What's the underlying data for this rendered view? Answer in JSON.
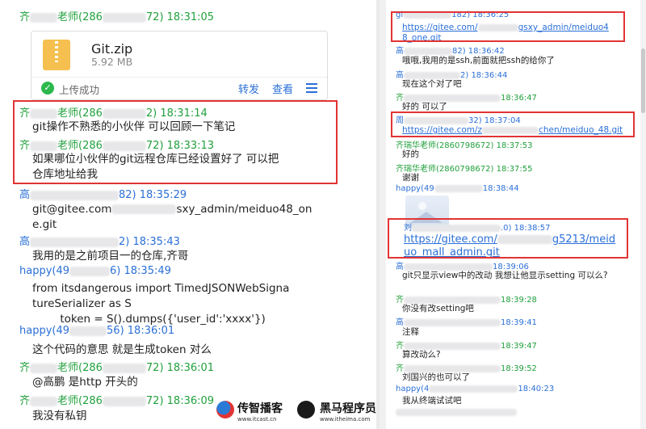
{
  "left": {
    "messages": [
      {
        "sender_a": "齐",
        "sender_b": "老师(286",
        "sender_c": "72) 18:31:05",
        "color": "green"
      },
      {
        "sender_a": "齐",
        "sender_b": "老师(286",
        "sender_c": "2) 18:31:14",
        "color": "green",
        "text": "git操作不熟悉的小伙伴 可以回顾一下笔记"
      },
      {
        "sender_a": "齐",
        "sender_b": "老师(286",
        "sender_c": "72) 18:33:13",
        "color": "green",
        "text": "如果哪位小伙伴的git远程仓库已经设置好了 可以把\n仓库地址给我"
      },
      {
        "sender_a": "高",
        "sender_b": "",
        "sender_c": "82) 18:35:29",
        "color": "blue",
        "text": "git@gitee.com",
        "text2": "sxy_admin/meiduo48_on\ne.git"
      },
      {
        "sender_a": "高",
        "sender_b": "",
        "sender_c": "2) 18:35:43",
        "color": "blue",
        "text": "我用的是之前项目一的仓库,齐哥"
      },
      {
        "sender_a": "happy(49",
        "sender_b": "",
        "sender_c": "6) 18:35:49",
        "color": "blue",
        "text": "from itsdangerous import TimedJSONWebSigna\ntureSerializer as S\n        token = S().dumps({'user_id':'xxxx'})"
      },
      {
        "sender_a": "happy(49",
        "sender_b": "",
        "sender_c": "56) 18:36:01",
        "color": "blue",
        "text": "这个代码的意思 就是生成token 对么"
      },
      {
        "sender_a": "齐",
        "sender_b": "老师(286",
        "sender_c": "72) 18:36:01",
        "color": "green",
        "text": "@高鹏 是http 开头的"
      },
      {
        "sender_a": "齐",
        "sender_b": "老师(286",
        "sender_c": "72) 18:36:09",
        "color": "green",
        "text": "我没有私钥"
      }
    ],
    "file": {
      "name": "Git.zip",
      "size": "5.92 MB",
      "status": "上传成功",
      "forward": "转发",
      "view": "查看"
    }
  },
  "right": {
    "messages": [
      {
        "hdr": "182) 18:36:25",
        "pre": "gi",
        "color": "blue"
      },
      {
        "link1": "https://gitee.com/",
        "link2": "gsxy_admin/meiduo4",
        "link3": "8_one.git"
      },
      {
        "hdr": "82) 18:36:42",
        "pre": "高",
        "color": "blue",
        "text": "哦哦,我用的是ssh,前面就把ssh的给你了"
      },
      {
        "hdr": "2) 18:36:44",
        "pre": "高",
        "color": "blue",
        "text": "现在这个对了吧"
      },
      {
        "hdr": "18:36:47",
        "pre": "齐",
        "color": "green",
        "text": "好的 可以了"
      },
      {
        "hdr": "32) 18:37:04",
        "pre": "周",
        "color": "blue"
      },
      {
        "link1": "https://gitee.com/z",
        "link2": "chen/meiduo_48.git"
      },
      {
        "hdr": "齐瑞华老师(2860798672) 18:37:53",
        "color": "green",
        "text": "好的"
      },
      {
        "hdr": "齐瑞华老师(2860798672) 18:37:55",
        "color": "green",
        "text": "谢谢"
      },
      {
        "hdr": "happy(49",
        "hdr2": "18:38:44",
        "color": "blue"
      },
      {
        "hdr": ".0) 18:38:57",
        "pre": "刘",
        "color": "blue"
      },
      {
        "link1": "https://gitee.com/",
        "link2": "g5213/meid",
        "link3": "uo_mall_admin.git"
      },
      {
        "hdr": "18:39:06",
        "pre": "高",
        "color": "blue",
        "text": "git只显示view中的改动 我想让他显示setting 可以么?"
      },
      {
        "hdr": "18:39:28",
        "pre": "齐",
        "color": "green",
        "text": "你没有改setting吧"
      },
      {
        "hdr": "18:39:41",
        "pre": "高",
        "color": "blue",
        "text": "注释"
      },
      {
        "hdr": "18:39:47",
        "pre": "齐",
        "color": "green",
        "text": "算改动么?"
      },
      {
        "hdr": "18:39:52",
        "pre": "齐",
        "color": "green",
        "text": "刘国兴的也可以了"
      },
      {
        "hdr": "18:40:23",
        "pre": "happy(4",
        "color": "blue",
        "text": "我从终端试试吧"
      }
    ]
  },
  "branding": {
    "logo1_cn": "传智播客",
    "logo1_url": "www.itcast.cn",
    "logo2_cn": "黑马程序员",
    "logo2_url": "www.itheima.com"
  }
}
